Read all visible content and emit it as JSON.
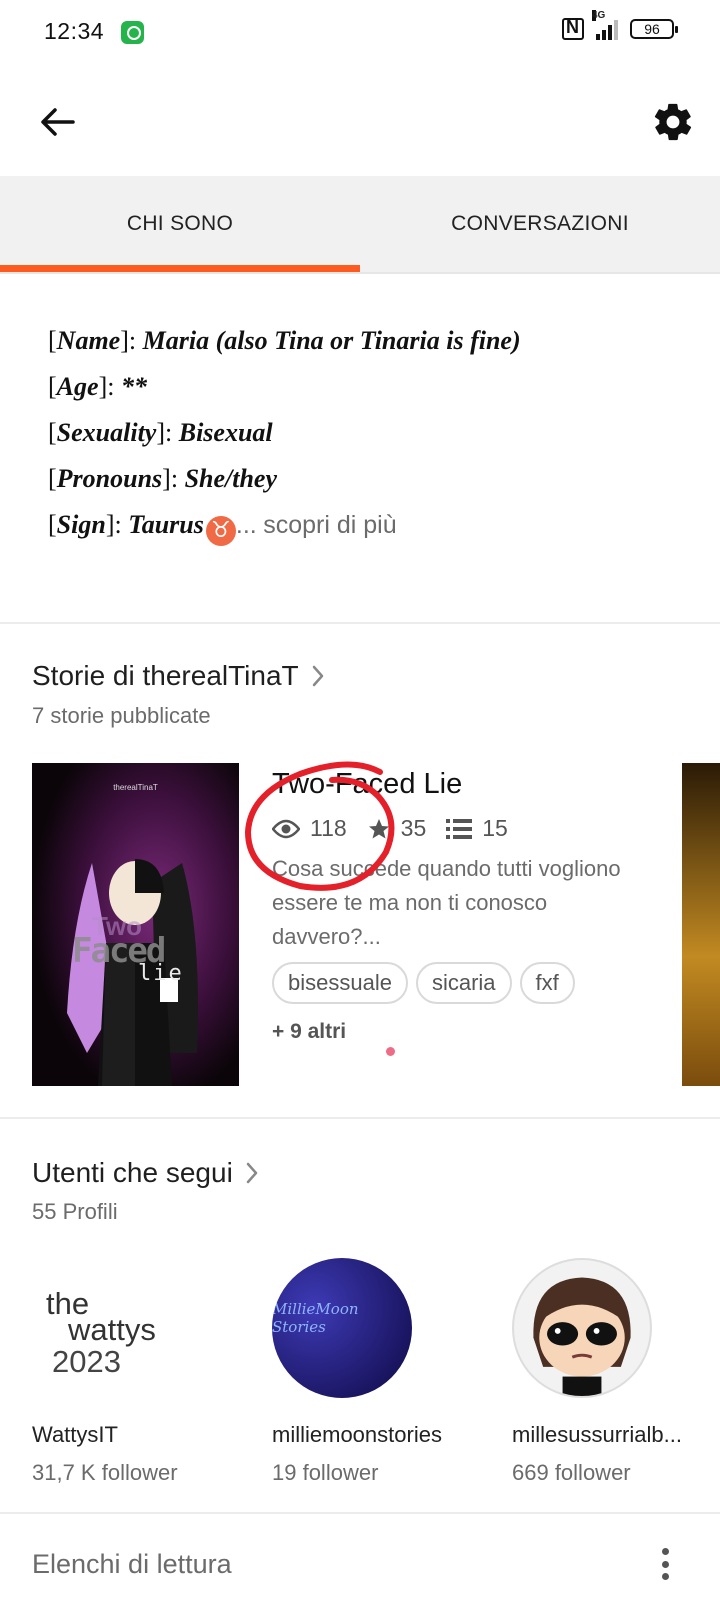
{
  "status_bar": {
    "time": "12:34",
    "network": "4G",
    "battery": "96"
  },
  "icons": {
    "back": "arrow-left-icon",
    "settings": "gear-icon",
    "chevron": "chevron-right-icon",
    "views": "eye-icon",
    "votes": "star-icon",
    "parts": "list-icon",
    "menu": "kebab-menu-icon"
  },
  "colors": {
    "accent": "#ff5a1f",
    "annotation": "#e4202a"
  },
  "tabs": [
    {
      "label": "CHI SONO",
      "active": true
    },
    {
      "label": "CONVERSAZIONI",
      "active": false
    }
  ],
  "bio": {
    "name_key": "Name",
    "name_value": "Maria (also Tina or Tinaria is fine)",
    "age_key": "Age",
    "age_value": "**",
    "sexuality_key": "Sexuality",
    "sexuality_value": "Bisexual",
    "pronouns_key": "Pronouns",
    "pronouns_value": "She/they",
    "sign_key": "Sign",
    "sign_value": "Taurus",
    "sign_glyph": "♉",
    "ellipsis": "...",
    "more_label": "scopri di più"
  },
  "stories": {
    "title": "Storie di therealTinaT",
    "subtitle": "7 storie pubblicate",
    "items": [
      {
        "title": "Two-Faced Lie",
        "cover_author": "therealTinaT",
        "cover_line1": "Two",
        "cover_line2": "Faced",
        "cover_line3": "lie",
        "views": "118",
        "votes": "35",
        "parts": "15",
        "description": "Cosa succede quando tutti vogliono essere te ma non ti conosco davvero?...",
        "tags": [
          "bisessuale",
          "sicaria",
          "fxf"
        ],
        "more_tags": "+ 9 altri"
      }
    ]
  },
  "following": {
    "title": "Utenti che segui",
    "subtitle": "55 Profili",
    "users": [
      {
        "name": "WattysIT",
        "followers": "31,7 K follower",
        "logo_line1": "the",
        "logo_line2": "wattys",
        "logo_line3": "2023"
      },
      {
        "name": "milliemoonstories",
        "followers": "19 follower",
        "avatar_text": "MillieMoon Stories"
      },
      {
        "name": "millesussurrialb...",
        "followers": "669 follower"
      }
    ]
  },
  "reading_lists": {
    "title": "Elenchi di lettura"
  }
}
